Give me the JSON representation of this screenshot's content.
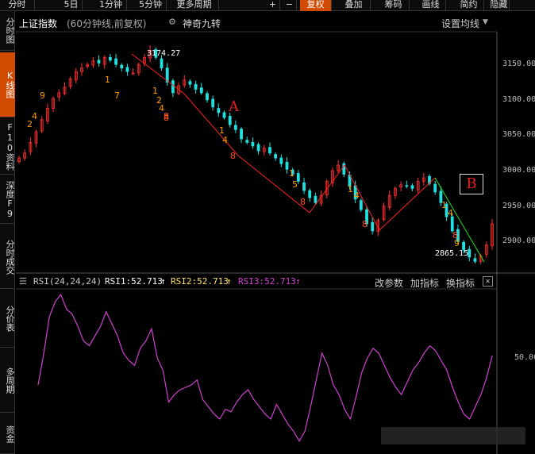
{
  "toolbar": {
    "buttons": [
      {
        "label": "分时"
      },
      {
        "label": "5日"
      },
      {
        "label": "1分钟"
      },
      {
        "label": "5分钟"
      },
      {
        "label": "更多周期"
      },
      {
        "label": "+"
      },
      {
        "label": "−"
      },
      {
        "label": "复权"
      },
      {
        "label": "叠加"
      },
      {
        "label": "筹码"
      },
      {
        "label": "画线"
      },
      {
        "label": "简约"
      },
      {
        "label": "隐藏"
      }
    ],
    "active_label": "复权"
  },
  "sidebar": {
    "tabs": [
      {
        "label": "分时图"
      },
      {
        "label": "K线图"
      },
      {
        "label": "F10资料"
      },
      {
        "label": "深度F9"
      },
      {
        "label": "分时成交"
      },
      {
        "label": "分价表"
      },
      {
        "label": "多周期"
      },
      {
        "label": "资金"
      }
    ]
  },
  "header": {
    "title": "上证指数",
    "subtitle": "(60分钟线,前复权)",
    "indicator": "神奇九转",
    "ma_setting": "设置均线"
  },
  "rsi_panel": {
    "name": "RSI(24,24,24)",
    "rsi1": "RSI1:52.713",
    "rsi2": "RSI2:52.713",
    "rsi3": "RSI3:52.713",
    "edit_params": "改参数",
    "add_indicator": "加指标",
    "switch_indicator": "换指标",
    "axis_label": "50.00"
  },
  "colors": {
    "up": "#ff3030",
    "down": "#20e0e0",
    "rsi_line": "#d040d0",
    "accent": "#d04a00",
    "nine_seq": "#ff9a00",
    "trend": "#ff2020",
    "green_trend": "#20e020"
  },
  "chart_data": {
    "type": "candlestick",
    "y_ticks": [
      "3150.00",
      "3100.00",
      "3050.00",
      "3000.00",
      "2950.00",
      "2900.00"
    ],
    "y_tick_values": [
      3150,
      3100,
      3050,
      3000,
      2950,
      2900
    ],
    "ylim": [
      2860,
      3185
    ],
    "high_label": "3174.27",
    "low_label": "2865.15",
    "annotations": [
      {
        "text": "A"
      },
      {
        "text": "B"
      }
    ],
    "closes": [
      3018,
      3025,
      3040,
      3055,
      3072,
      3088,
      3102,
      3110,
      3118,
      3130,
      3140,
      3145,
      3150,
      3155,
      3152,
      3160,
      3156,
      3150,
      3145,
      3140,
      3138,
      3150,
      3160,
      3170,
      3160,
      3145,
      3125,
      3110,
      3120,
      3128,
      3122,
      3115,
      3110,
      3100,
      3090,
      3082,
      3075,
      3065,
      3058,
      3045,
      3040,
      3035,
      3028,
      3032,
      3025,
      3018,
      3010,
      3002,
      2995,
      2985,
      2972,
      2962,
      2955,
      2965,
      2985,
      3000,
      3008,
      2995,
      2978,
      2960,
      2945,
      2925,
      2915,
      2930,
      2950,
      2965,
      2975,
      2980,
      2978,
      2975,
      2985,
      2990,
      2982,
      2970,
      2955,
      2935,
      2915,
      2900,
      2888,
      2878,
      2872,
      2880,
      2895,
      2925
    ],
    "rsi_values": [
      42,
      55,
      70,
      76,
      79,
      73,
      71,
      66,
      60,
      58,
      62,
      66,
      72,
      67,
      62,
      55,
      52,
      50,
      57,
      60,
      65,
      53,
      48,
      35,
      38,
      40,
      41,
      42,
      44,
      36,
      33,
      30,
      28,
      32,
      31,
      35,
      38,
      40,
      36,
      33,
      30,
      28,
      34,
      30,
      26,
      23,
      19,
      23,
      33,
      44,
      55,
      50,
      42,
      38,
      32,
      28,
      37,
      47,
      53,
      57,
      55,
      50,
      45,
      41,
      38,
      43,
      48,
      51,
      55,
      58,
      56,
      52,
      48,
      41,
      35,
      30,
      28,
      33,
      38,
      45,
      54
    ],
    "nine_counts": [
      {
        "text": "2"
      },
      {
        "text": "4"
      },
      {
        "text": "9"
      },
      {
        "text": "1"
      },
      {
        "text": "7"
      },
      {
        "text": "8"
      },
      {
        "text": "1"
      },
      {
        "text": "2"
      },
      {
        "text": "4"
      },
      {
        "text": "8"
      },
      {
        "text": "1"
      },
      {
        "text": "4"
      },
      {
        "text": "8"
      },
      {
        "text": "1"
      },
      {
        "text": "5"
      },
      {
        "text": "8"
      },
      {
        "text": "1"
      },
      {
        "text": "4"
      },
      {
        "text": "8"
      },
      {
        "text": "9"
      },
      {
        "text": "1"
      },
      {
        "text": "4"
      },
      {
        "text": "8"
      }
    ]
  }
}
